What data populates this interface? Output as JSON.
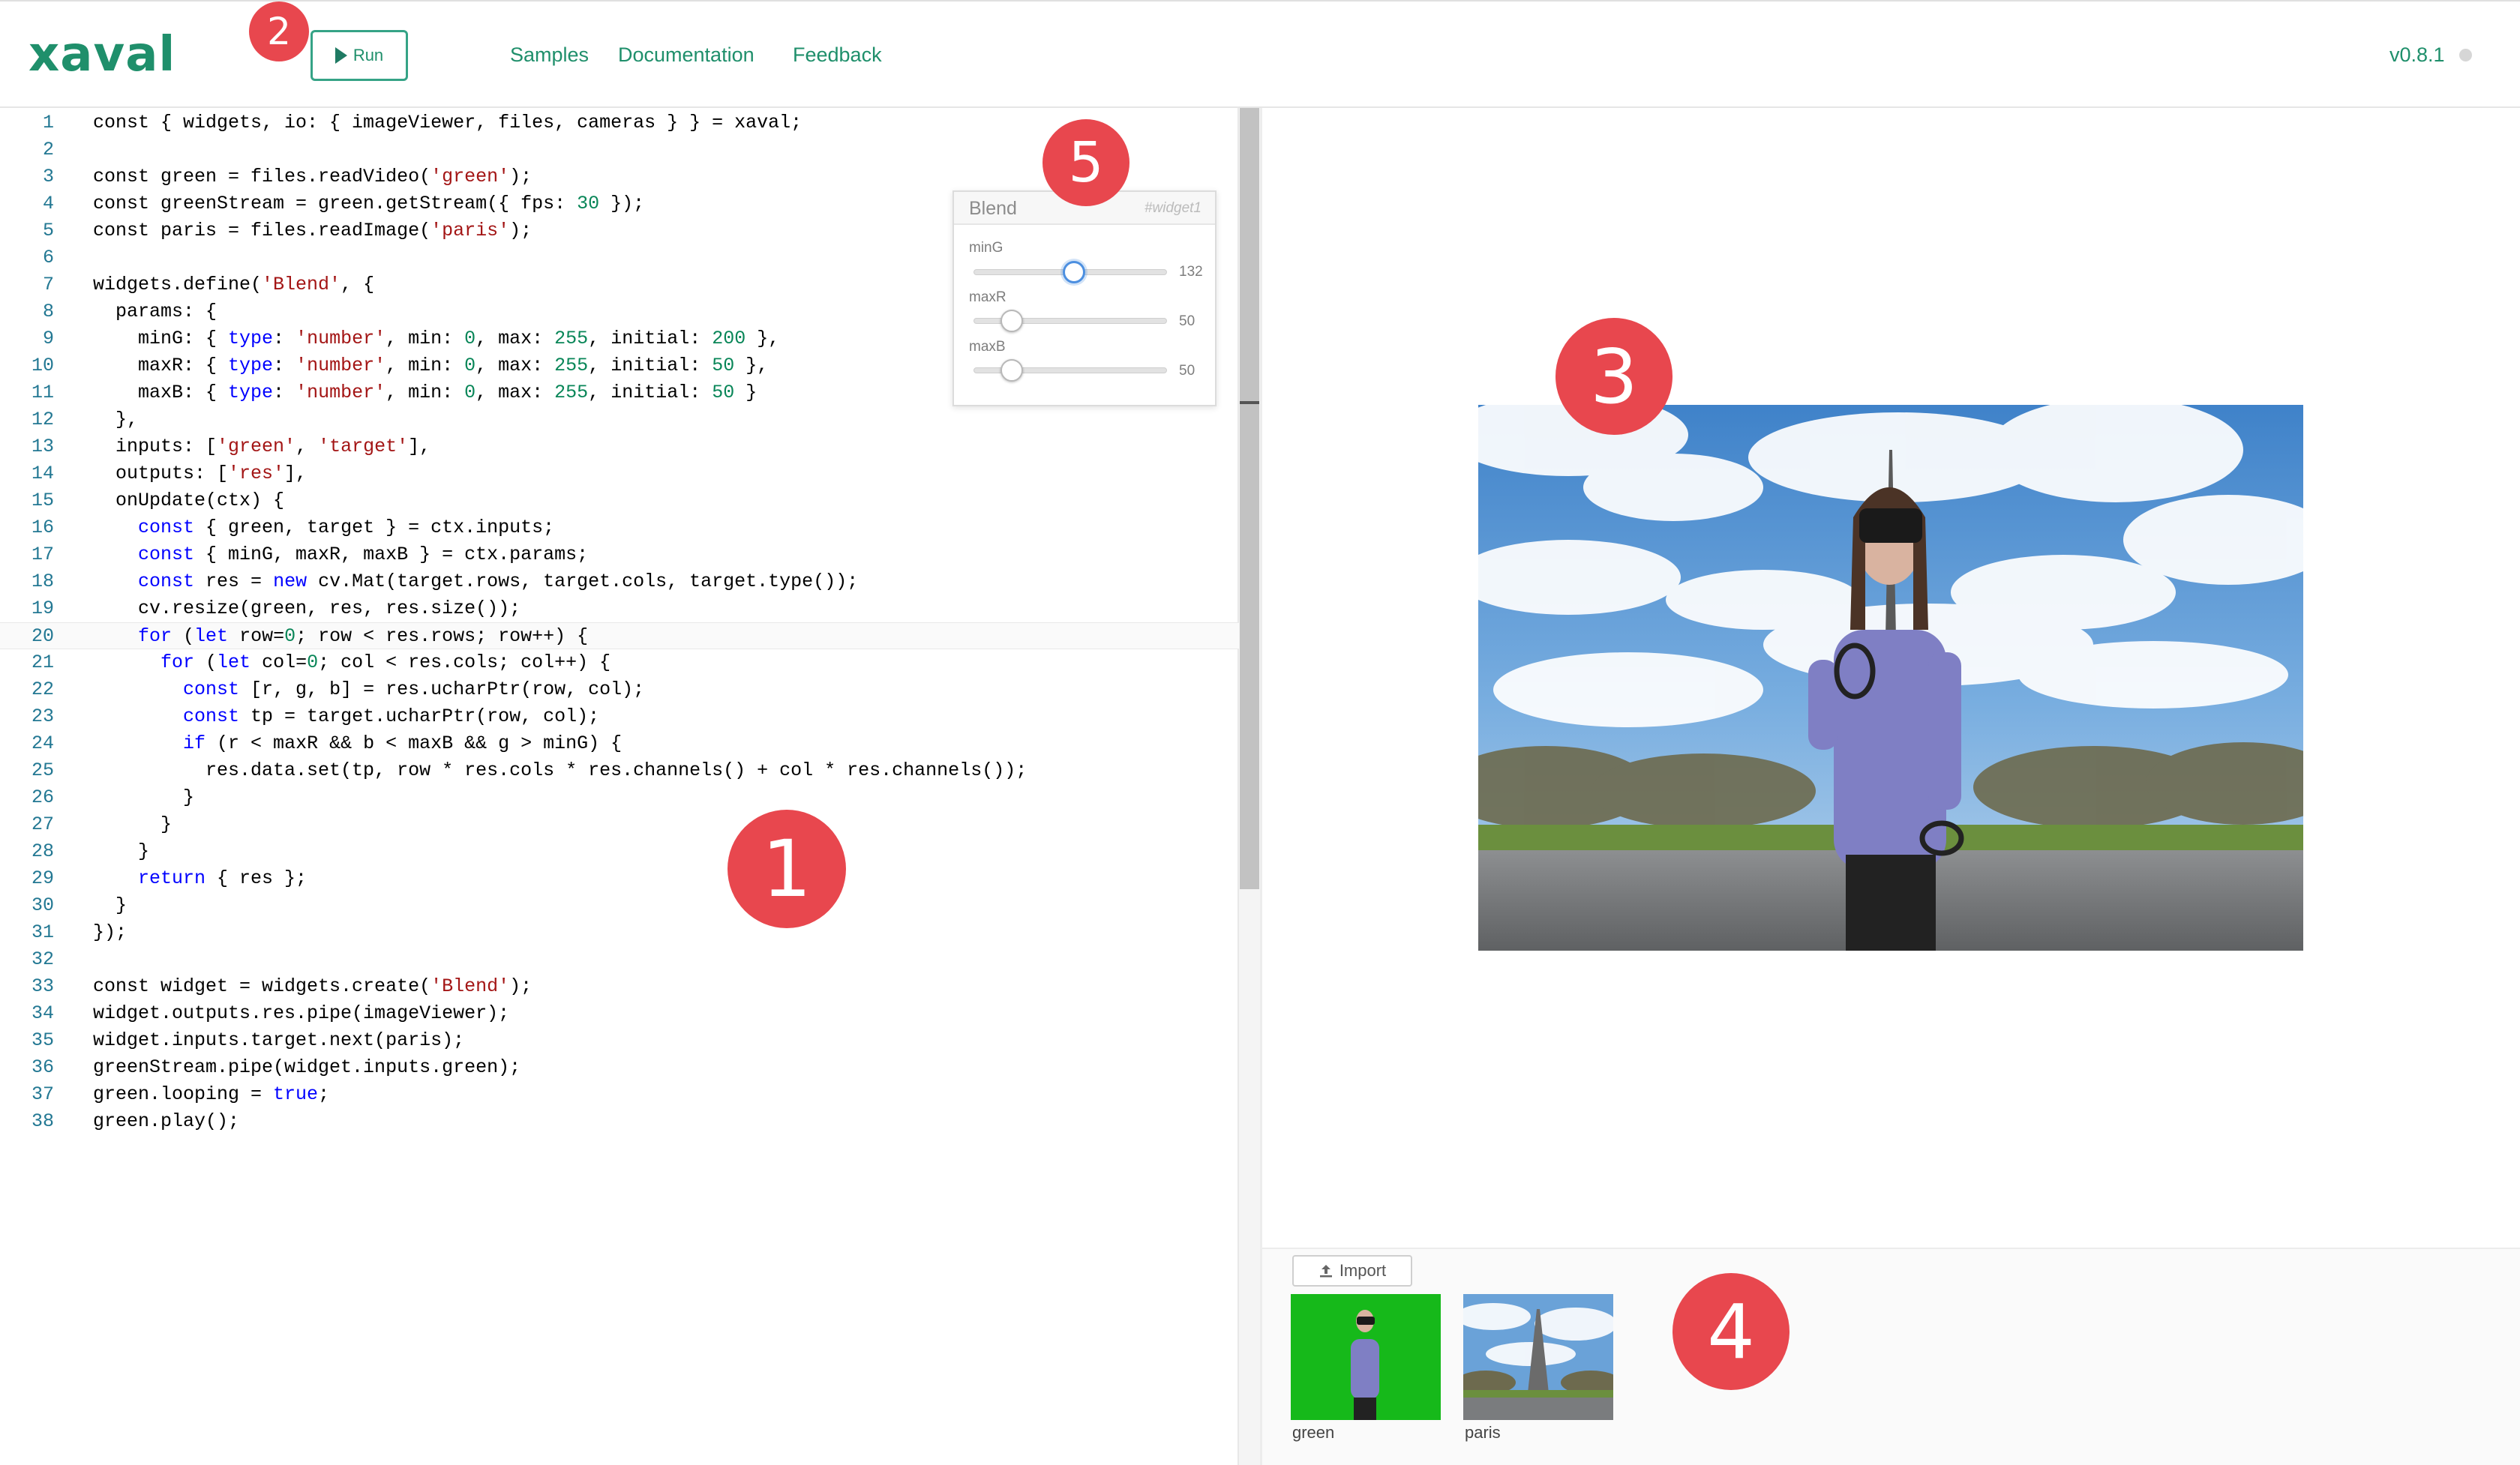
{
  "app": {
    "logo": "xaval",
    "version": "v0.8.1"
  },
  "toolbar": {
    "run_label": "Run"
  },
  "nav": {
    "samples": "Samples",
    "documentation": "Documentation",
    "feedback": "Feedback"
  },
  "editor": {
    "lines": [
      [
        [
          "",
          "const { widgets, io: { imageViewer, files, cameras } } = xaval;"
        ]
      ],
      [],
      [
        [
          "",
          "const green = files.readVideo("
        ],
        [
          "str",
          "'green'"
        ],
        [
          "",
          ");"
        ]
      ],
      [
        [
          "",
          "const greenStream = green.getStream({ fps: "
        ],
        [
          "num",
          "30"
        ],
        [
          "",
          " });"
        ]
      ],
      [
        [
          "",
          "const paris = files.readImage("
        ],
        [
          "str",
          "'paris'"
        ],
        [
          "",
          ");"
        ]
      ],
      [],
      [
        [
          "",
          "widgets.define("
        ],
        [
          "str",
          "'Blend'"
        ],
        [
          "",
          ", {"
        ]
      ],
      [
        [
          "",
          "  params: {"
        ]
      ],
      [
        [
          "",
          "    minG: { "
        ],
        [
          "kw",
          "type"
        ],
        [
          "",
          ": "
        ],
        [
          "str",
          "'number'"
        ],
        [
          "",
          ", min: "
        ],
        [
          "num",
          "0"
        ],
        [
          "",
          ", max: "
        ],
        [
          "num",
          "255"
        ],
        [
          "",
          ", initial: "
        ],
        [
          "num",
          "200"
        ],
        [
          "",
          " },"
        ]
      ],
      [
        [
          "",
          "    maxR: { "
        ],
        [
          "kw",
          "type"
        ],
        [
          "",
          ": "
        ],
        [
          "str",
          "'number'"
        ],
        [
          "",
          ", min: "
        ],
        [
          "num",
          "0"
        ],
        [
          "",
          ", max: "
        ],
        [
          "num",
          "255"
        ],
        [
          "",
          ", initial: "
        ],
        [
          "num",
          "50"
        ],
        [
          "",
          " },"
        ]
      ],
      [
        [
          "",
          "    maxB: { "
        ],
        [
          "kw",
          "type"
        ],
        [
          "",
          ": "
        ],
        [
          "str",
          "'number'"
        ],
        [
          "",
          ", min: "
        ],
        [
          "num",
          "0"
        ],
        [
          "",
          ", max: "
        ],
        [
          "num",
          "255"
        ],
        [
          "",
          ", initial: "
        ],
        [
          "num",
          "50"
        ],
        [
          "",
          " }"
        ]
      ],
      [
        [
          "",
          "  },"
        ]
      ],
      [
        [
          "",
          "  inputs: ["
        ],
        [
          "str",
          "'green'"
        ],
        [
          "",
          ", "
        ],
        [
          "str",
          "'target'"
        ],
        [
          "",
          "],"
        ]
      ],
      [
        [
          "",
          "  outputs: ["
        ],
        [
          "str",
          "'res'"
        ],
        [
          "",
          "],"
        ]
      ],
      [
        [
          "",
          "  onUpdate(ctx) {"
        ]
      ],
      [
        [
          "",
          "    "
        ],
        [
          "kw",
          "const"
        ],
        [
          "",
          " { green, target } = ctx.inputs;"
        ]
      ],
      [
        [
          "",
          "    "
        ],
        [
          "kw",
          "const"
        ],
        [
          "",
          " { minG, maxR, maxB } = ctx.params;"
        ]
      ],
      [
        [
          "",
          "    "
        ],
        [
          "kw",
          "const"
        ],
        [
          "",
          " res = "
        ],
        [
          "kw",
          "new"
        ],
        [
          "",
          " cv.Mat(target.rows, target.cols, target.type());"
        ]
      ],
      [
        [
          "",
          "    cv.resize(green, res, res.size());"
        ]
      ],
      [
        [
          "",
          "    "
        ],
        [
          "kw",
          "for"
        ],
        [
          "",
          " ("
        ],
        [
          "kw",
          "let"
        ],
        [
          "",
          " row="
        ],
        [
          "num",
          "0"
        ],
        [
          "",
          "; row < res.rows; row++) {"
        ]
      ],
      [
        [
          "",
          "      "
        ],
        [
          "kw",
          "for"
        ],
        [
          "",
          " ("
        ],
        [
          "kw",
          "let"
        ],
        [
          "",
          " col="
        ],
        [
          "num",
          "0"
        ],
        [
          "",
          "; col < res.cols; col++) {"
        ]
      ],
      [
        [
          "",
          "        "
        ],
        [
          "kw",
          "const"
        ],
        [
          "",
          " [r, g, b] = res.ucharPtr(row, col);"
        ]
      ],
      [
        [
          "",
          "        "
        ],
        [
          "kw",
          "const"
        ],
        [
          "",
          " tp = target.ucharPtr(row, col);"
        ]
      ],
      [
        [
          "",
          "        "
        ],
        [
          "kw",
          "if"
        ],
        [
          "",
          " (r < maxR && b < maxB && g > minG) {"
        ]
      ],
      [
        [
          "",
          "          res.data.set(tp, row * res.cols * res.channels() + col * res.channels());"
        ]
      ],
      [
        [
          "",
          "        }"
        ]
      ],
      [
        [
          "",
          "      }"
        ]
      ],
      [
        [
          "",
          "    }"
        ]
      ],
      [
        [
          "",
          "    "
        ],
        [
          "kw",
          "return"
        ],
        [
          "",
          " { res };"
        ]
      ],
      [
        [
          "",
          "  }"
        ]
      ],
      [
        [
          "",
          "});"
        ]
      ],
      [],
      [
        [
          "",
          "const widget = widgets.create("
        ],
        [
          "str",
          "'Blend'"
        ],
        [
          "",
          ");"
        ]
      ],
      [
        [
          "",
          "widget.outputs.res.pipe(imageViewer);"
        ]
      ],
      [
        [
          "",
          "widget.inputs.target.next(paris);"
        ]
      ],
      [
        [
          "",
          "greenStream.pipe(widget.inputs.green);"
        ]
      ],
      [
        [
          "",
          "green.looping = "
        ],
        [
          "kw",
          "true"
        ],
        [
          "",
          ";"
        ]
      ],
      [
        [
          "",
          "green.play();"
        ]
      ]
    ]
  },
  "widget": {
    "title": "Blend",
    "id": "#widget1",
    "params": [
      {
        "label": "minG",
        "value": 132,
        "max": 255
      },
      {
        "label": "maxR",
        "value": 50,
        "max": 255
      },
      {
        "label": "maxB",
        "value": 50,
        "max": 255
      }
    ]
  },
  "files": {
    "import_label": "Import",
    "items": [
      {
        "label": "green"
      },
      {
        "label": "paris"
      }
    ]
  },
  "annotations": [
    "1",
    "2",
    "3",
    "4",
    "5"
  ],
  "colors": {
    "brand": "#1f8f6b",
    "badge": "#e8474e",
    "green_screen": "#16b91a",
    "keyword": "#0000ff",
    "string": "#a31515",
    "number": "#098658"
  },
  "icons": [
    "play-icon",
    "upload-icon",
    "status-dot-icon"
  ]
}
